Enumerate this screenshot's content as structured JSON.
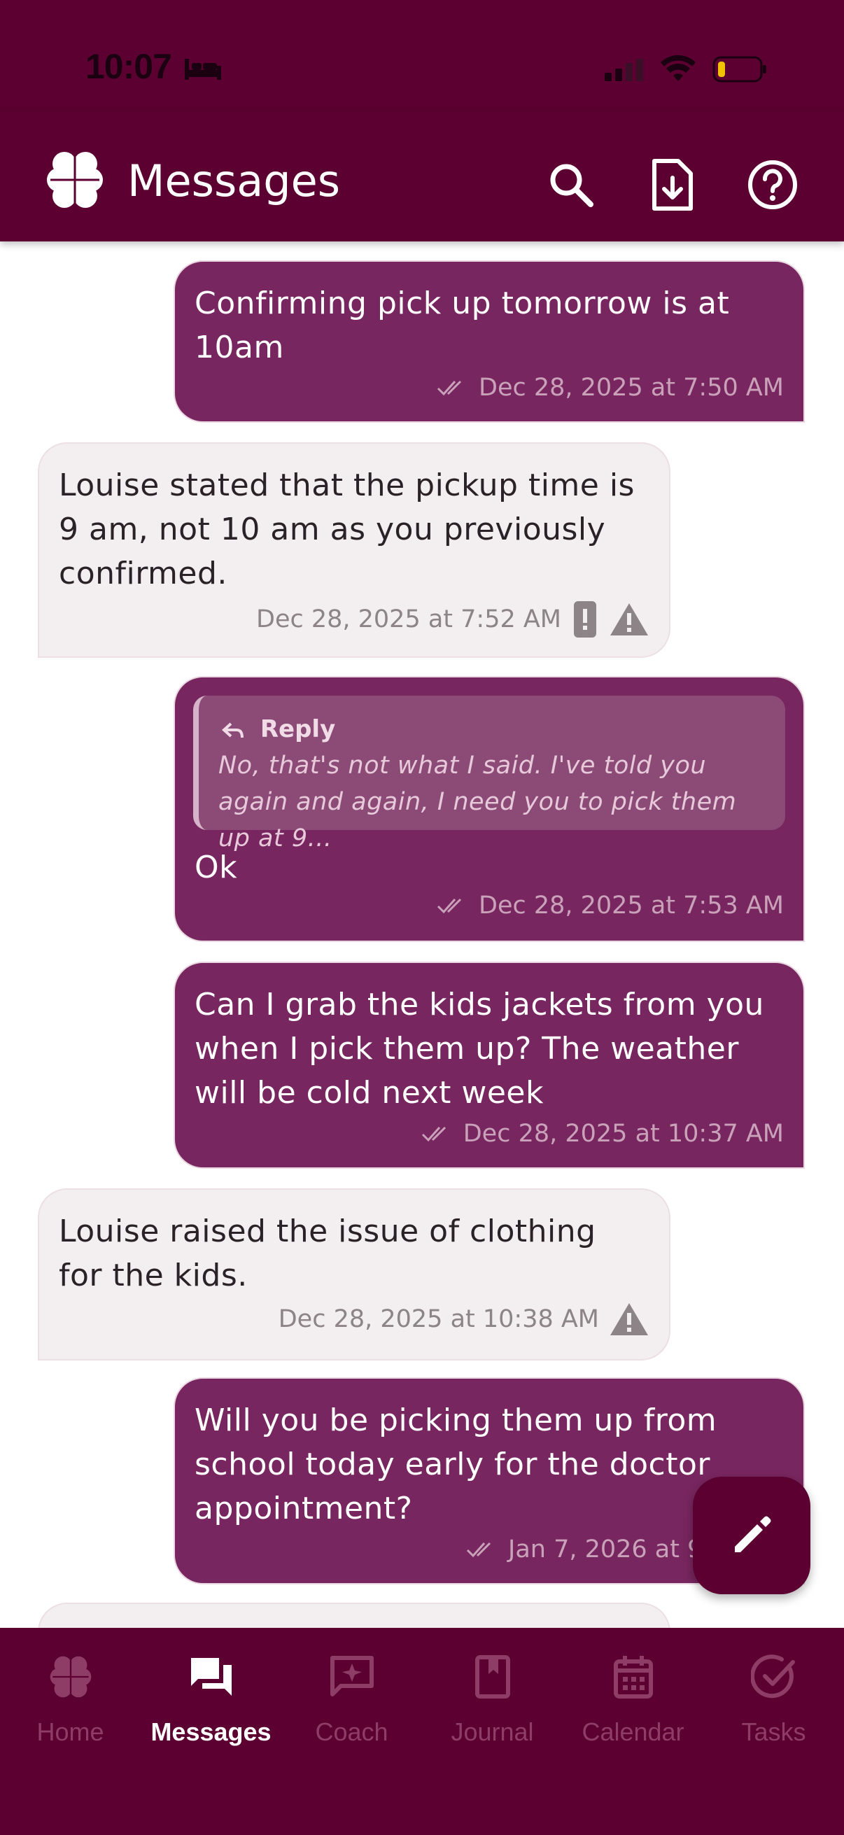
{
  "status_bar": {
    "time": "10:07"
  },
  "header": {
    "title": "Messages",
    "logo_icon": "clover-logo-icon"
  },
  "header_actions": [
    "search-icon",
    "export-document-icon",
    "help-icon"
  ],
  "messages": [
    {
      "direction": "outgoing",
      "text": "Confirming pick up tomorrow is at 10am",
      "timestamp": "Dec 28, 2025 at 7:50 AM",
      "status": "read"
    },
    {
      "direction": "incoming",
      "text": "Louise stated that the pickup time is 9 am, not 10 am as you previously confirmed.",
      "timestamp": "Dec 28, 2025 at 7:52 AM",
      "flags": [
        "report-icon",
        "warning-icon"
      ]
    },
    {
      "direction": "outgoing",
      "reply_label": "Reply",
      "reply_quote": "No, that's not what I said. I've told you again and again, I need you to pick them up at 9...",
      "text": "Ok",
      "timestamp": "Dec 28, 2025 at 7:53 AM",
      "status": "read"
    },
    {
      "direction": "outgoing",
      "text": "Can I grab the kids jackets from you when I pick them up? The weather will be cold next week",
      "timestamp": "Dec 28, 2025 at 10:37 AM",
      "status": "read"
    },
    {
      "direction": "incoming",
      "text": "Louise raised the issue of clothing for the kids.",
      "timestamp": "Dec 28, 2025 at 10:38 AM",
      "flags": [
        "warning-icon"
      ]
    },
    {
      "direction": "outgoing",
      "text": "Will you be picking them up from school today early for the doctor appointment?",
      "timestamp": "Jan 7, 2026 at 9",
      "status": "read"
    }
  ],
  "nav": [
    {
      "label": "Home",
      "icon": "clover-icon",
      "active": false
    },
    {
      "label": "Messages",
      "icon": "chat-bubbles-icon",
      "active": true
    },
    {
      "label": "Coach",
      "icon": "coach-sparkle-icon",
      "active": false
    },
    {
      "label": "Journal",
      "icon": "journal-icon",
      "active": false
    },
    {
      "label": "Calendar",
      "icon": "calendar-icon",
      "active": false
    },
    {
      "label": "Tasks",
      "icon": "check-circle-icon",
      "active": false
    }
  ],
  "fab": {
    "icon": "pencil-icon"
  },
  "colors": {
    "primary": "#5b0030",
    "outgoing_bubble": "#78265f",
    "incoming_bubble": "#f3eeef",
    "inactive_nav": "#8e3d67"
  }
}
